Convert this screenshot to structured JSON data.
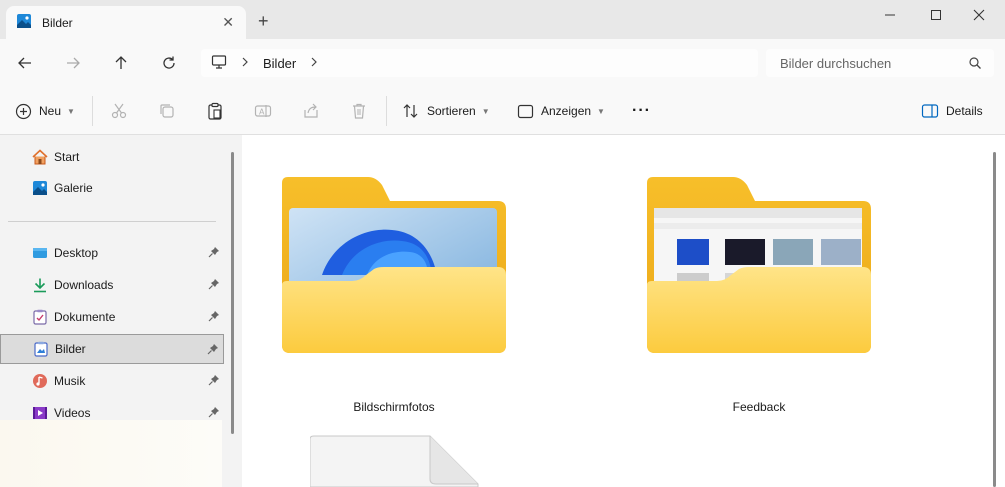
{
  "window": {
    "tab_title": "Bilder",
    "tab_close": "✕",
    "new_tab": "+"
  },
  "address": {
    "crumbs": [
      "Bilder"
    ],
    "search_placeholder": "Bilder durchsuchen"
  },
  "toolbar": {
    "new_label": "Neu",
    "sort_label": "Sortieren",
    "view_label": "Anzeigen",
    "more_label": "···",
    "details_label": "Details"
  },
  "sidebar": {
    "items": [
      {
        "label": "Start",
        "icon": "home-icon"
      },
      {
        "label": "Galerie",
        "icon": "gallery-icon"
      },
      {
        "label": "Desktop",
        "icon": "desktop-folder-icon",
        "pinned": true
      },
      {
        "label": "Downloads",
        "icon": "downloads-icon",
        "pinned": true
      },
      {
        "label": "Dokumente",
        "icon": "documents-icon",
        "pinned": true
      },
      {
        "label": "Bilder",
        "icon": "pictures-icon",
        "pinned": true,
        "selected": true
      },
      {
        "label": "Musik",
        "icon": "music-icon",
        "pinned": true
      },
      {
        "label": "Videos",
        "icon": "videos-icon",
        "pinned": true
      }
    ]
  },
  "content": {
    "folders": [
      {
        "name": "Bildschirmfotos"
      },
      {
        "name": "Feedback"
      }
    ]
  },
  "colors": {
    "folder_back": "#f5b81c",
    "folder_front": "#ffd867",
    "accent": "#0067c0",
    "selected_bg": "#dcdcdc"
  }
}
